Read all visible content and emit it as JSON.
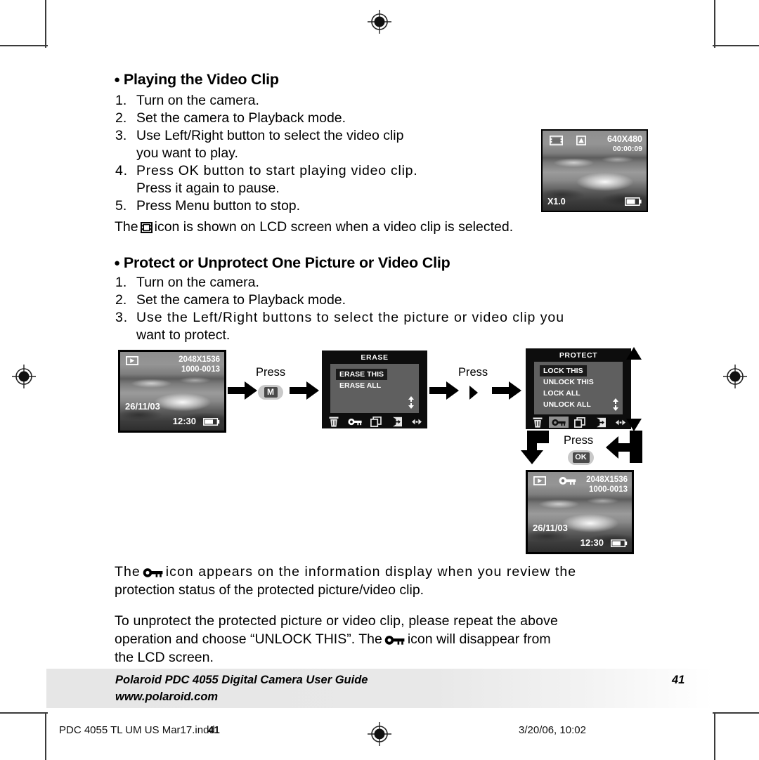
{
  "page": {
    "number": "41",
    "background": "#ffffff"
  },
  "sections": [
    {
      "heading": "Playing the Video Clip",
      "steps": [
        {
          "num": "1.",
          "text": "Turn on the camera."
        },
        {
          "num": "2.",
          "text": "Set the camera to Playback mode."
        },
        {
          "num": "3.",
          "text": "Use Left/Right button to select the video clip"
        },
        {
          "num": "",
          "text": "you want to play."
        },
        {
          "num": "4.",
          "text": "Press OK button to start playing video clip."
        },
        {
          "num": "",
          "text": "Press it again to pause."
        },
        {
          "num": "5.",
          "text": "Press Menu button to stop."
        }
      ]
    },
    {
      "heading": "Protect or Unprotect One Picture or Video Clip",
      "steps": [
        {
          "num": "1.",
          "text": "Turn on the camera."
        },
        {
          "num": "2.",
          "text": "Set the camera to Playback mode."
        },
        {
          "num": "3.",
          "text": "Use the Left/Right buttons to select the picture or video clip you"
        },
        {
          "num": "",
          "text": "want to protect."
        }
      ]
    }
  ],
  "notes": {
    "video_icon_note_before": "The",
    "video_icon_note_after": "icon is shown on LCD screen when a video clip is selected.",
    "protect_note_before": "The",
    "protect_note_after_line1": "icon appears on the information display when you review the",
    "protect_note_after_line2": "protection status of the protected picture/video clip.",
    "unprotect_line1": "To unprotect the protected picture or video clip, please repeat the above",
    "unprotect_line2a": "operation and choose “UNLOCK THIS”. The",
    "unprotect_line2b": "icon will disappear from",
    "unprotect_line3": "the LCD screen."
  },
  "screens": {
    "video_playback": {
      "mode_icon": "film-strip-icon",
      "second_icon": "video-marker-icon",
      "resolution": "640X480",
      "timecode": "00:00:09",
      "zoom": "X1.0",
      "battery_icon": "battery-icon"
    },
    "picture_playback": {
      "mode_icon": "playback-icon",
      "resolution": "2048X1536",
      "file_number": "1000-0013",
      "date": "26/11/03",
      "time": "12:30",
      "battery_icon": "battery-icon"
    },
    "picture_protected": {
      "mode_icon": "playback-icon",
      "protect_icon": "key-icon",
      "resolution": "2048X1536",
      "file_number": "1000-0013",
      "date": "26/11/03",
      "time": "12:30",
      "battery_icon": "battery-icon"
    },
    "erase_menu": {
      "title": "ERASE",
      "items": [
        {
          "label": "ERASE THIS",
          "selected": true
        },
        {
          "label": "ERASE ALL",
          "selected": false
        }
      ],
      "toolbar_icons": [
        "trash-icon",
        "key-icon",
        "copy-icon",
        "exit-icon",
        "left-right-icon"
      ],
      "active_toolbar_icon": "trash-icon",
      "scroll_icon": "up-down-arrows-icon"
    },
    "protect_menu": {
      "title": "PROTECT",
      "items": [
        {
          "label": "LOCK THIS",
          "selected": true
        },
        {
          "label": "UNLOCK THIS",
          "selected": false
        },
        {
          "label": "LOCK ALL",
          "selected": false
        },
        {
          "label": "UNLOCK ALL",
          "selected": false
        }
      ],
      "toolbar_icons": [
        "trash-icon",
        "key-icon",
        "copy-icon",
        "exit-icon",
        "left-right-icon"
      ],
      "active_toolbar_icon": "key-icon",
      "scroll_icon": "up-down-arrows-icon"
    }
  },
  "flow": {
    "press_menu": {
      "label": "Press",
      "button": "M"
    },
    "press_right": {
      "label": "Press",
      "button": "play-right-icon"
    },
    "press_ok": {
      "label": "Press",
      "button": "OK"
    }
  },
  "footer": {
    "line1": "Polaroid PDC 4055 Digital Camera User Guide",
    "line2": "www.polaroid.com",
    "page": "41"
  },
  "print_marks": {
    "filename": "PDC 4055 TL UM US Mar17.indd",
    "overlay_page": "41",
    "timestamp": "3/20/06, 10:02",
    "registration_icon": "registration-target-icon"
  }
}
